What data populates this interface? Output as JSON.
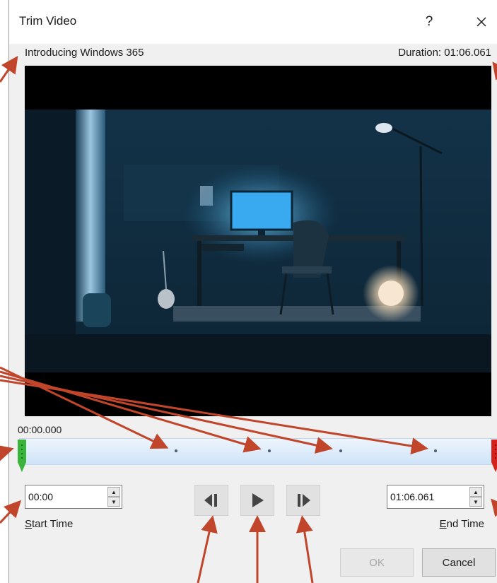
{
  "dialog": {
    "title": "Trim Video",
    "help_label": "?"
  },
  "video": {
    "name": "Introducing Windows 365",
    "duration": "Duration: 01:06.061",
    "current_time": "00:00.000"
  },
  "start": {
    "value": "00:00",
    "label_accel": "S",
    "label_rest": "tart Time"
  },
  "end": {
    "value": "01:06.061",
    "label_accel": "E",
    "label_rest": "nd Time"
  },
  "buttons": {
    "ok": "OK",
    "cancel": "Cancel"
  },
  "colors": {
    "annotation": "#c0452a",
    "start_marker": "#3bb43b",
    "end_marker": "#d6201c",
    "track": "#d7e8fa"
  }
}
